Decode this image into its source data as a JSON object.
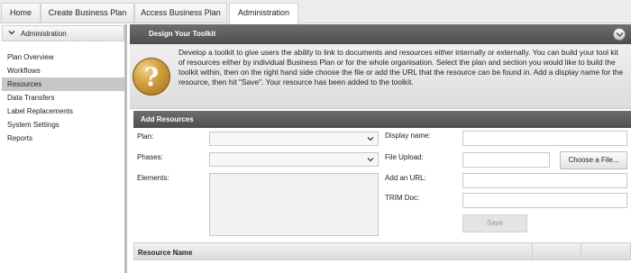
{
  "topnav": {
    "tabs": [
      {
        "label": "Home"
      },
      {
        "label": "Create Business Plan"
      },
      {
        "label": "Access Business Plan"
      },
      {
        "label": "Administration",
        "active": true
      }
    ]
  },
  "sidebar": {
    "header": "Administration",
    "items": [
      {
        "label": "Plan Overview"
      },
      {
        "label": "Workflows"
      },
      {
        "label": "Resources",
        "active": true
      },
      {
        "label": "Data Transfers"
      },
      {
        "label": "Label Replacements"
      },
      {
        "label": "System Settings"
      },
      {
        "label": "Reports"
      }
    ]
  },
  "main": {
    "panel_title": "Design Your Toolkit",
    "intro": "Develop a toolkit to give users the ability to link to documents and resources either internally or externally. You can build your tool kit of resources either by individual Business Plan or for the whole organisation. Select the plan and section you would like to build the toolkit within, then on the right hand side choose the file or add the URL that the resource can be found in. Add a display name for the resource, then hit \"Save\". Your resource has been added to the toolkit.",
    "intro_icon": "question-icon",
    "add_resources": {
      "title": "Add Resources",
      "plan_label": "Plan:",
      "plan_value": "",
      "phases_label": "Phases:",
      "phases_value": "",
      "elements_label": "Elements:",
      "display_name_label": "Display name:",
      "display_name_value": "",
      "file_upload_label": "File Upload:",
      "choose_file_label": "Choose a File...",
      "url_label": "Add an URL:",
      "url_value": "",
      "trim_label": "TRIM Doc:",
      "trim_value": "",
      "save_label": "Save"
    },
    "grid": {
      "columns": [
        "Resource Name",
        "",
        ""
      ]
    }
  },
  "colors": {
    "header_dark": "#5a5a5a",
    "active_item": "#c7c7c7",
    "icon_gold": "#c8962f"
  }
}
